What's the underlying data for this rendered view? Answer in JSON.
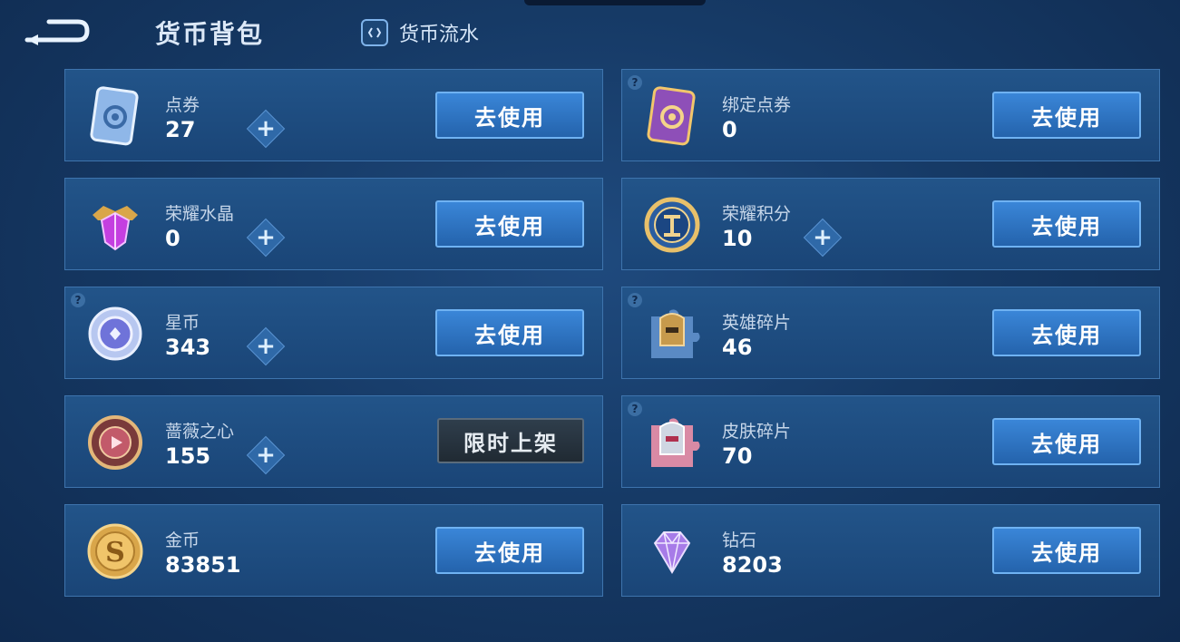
{
  "header": {
    "title": "货币背包",
    "flow_label": "货币流水"
  },
  "cards": [
    {
      "label": "点券",
      "count": "27",
      "button": "去使用",
      "icon": "ticket-icon",
      "plus": true,
      "help": false
    },
    {
      "label": "绑定点券",
      "count": "0",
      "button": "去使用",
      "icon": "bound-ticket-icon",
      "plus": false,
      "help": true
    },
    {
      "label": "荣耀水晶",
      "count": "0",
      "button": "去使用",
      "icon": "glory-crystal-icon",
      "plus": true,
      "help": false
    },
    {
      "label": "荣耀积分",
      "count": "10",
      "button": "去使用",
      "icon": "glory-points-icon",
      "plus": true,
      "help": false
    },
    {
      "label": "星币",
      "count": "343",
      "button": "去使用",
      "icon": "star-coin-icon",
      "plus": true,
      "help": true
    },
    {
      "label": "英雄碎片",
      "count": "46",
      "button": "去使用",
      "icon": "hero-fragment-icon",
      "plus": false,
      "help": true
    },
    {
      "label": "蔷薇之心",
      "count": "155",
      "button": "限时上架",
      "icon": "rose-heart-icon",
      "plus": true,
      "help": false
    },
    {
      "label": "皮肤碎片",
      "count": "70",
      "button": "去使用",
      "icon": "skin-fragment-icon",
      "plus": false,
      "help": true
    },
    {
      "label": "金币",
      "count": "83851",
      "button": "去使用",
      "icon": "gold-coin-icon",
      "plus": false,
      "help": false
    },
    {
      "label": "钻石",
      "count": "8203",
      "button": "去使用",
      "icon": "diamond-icon",
      "plus": false,
      "help": false
    }
  ],
  "help_mark": "?",
  "plus_mark": "+"
}
